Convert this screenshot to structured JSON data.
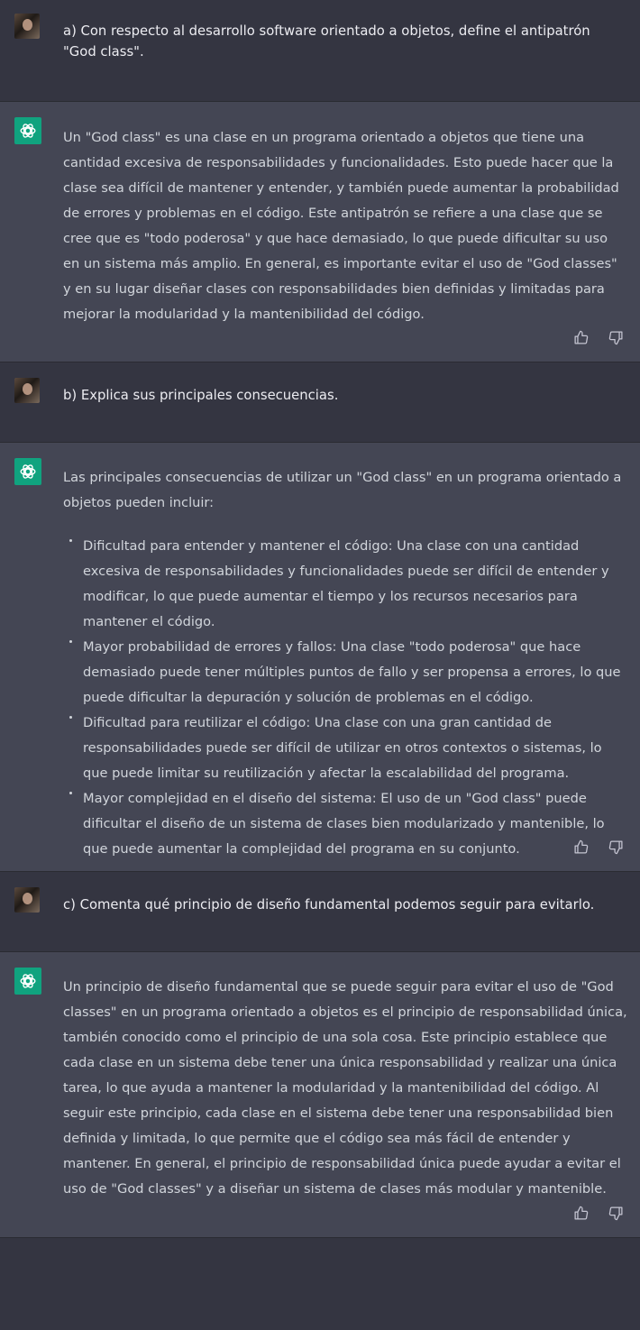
{
  "theme": {
    "user_bg": "#343541",
    "assistant_bg": "#444654",
    "accent": "#10a37f"
  },
  "messages": [
    {
      "role": "user",
      "text": "a) Con respecto al desarrollo software orientado a objetos, define el antipatrón \"God class\"."
    },
    {
      "role": "assistant",
      "text": "Un \"God class\" es una clase en un programa orientado a objetos que tiene una cantidad excesiva de responsabilidades y funcionalidades. Esto puede hacer que la clase sea difícil de mantener y entender, y también puede aumentar la probabilidad de errores y problemas en el código. Este antipatrón se refiere a una clase que se cree que es \"todo poderosa\" y que hace demasiado, lo que puede dificultar su uso en un sistema más amplio. En general, es importante evitar el uso de \"God classes\" y en su lugar diseñar clases con responsabilidades bien definidas y limitadas para mejorar la modularidad y la mantenibilidad del código."
    },
    {
      "role": "user",
      "text": "b) Explica sus principales consecuencias."
    },
    {
      "role": "assistant",
      "intro": "Las principales consecuencias de utilizar un \"God class\" en un programa orientado a objetos pueden incluir:",
      "bullets": [
        "Dificultad para entender y mantener el código: Una clase con una cantidad excesiva de responsabilidades y funcionalidades puede ser difícil de entender y modificar, lo que puede aumentar el tiempo y los recursos necesarios para mantener el código.",
        "Mayor probabilidad de errores y fallos: Una clase \"todo poderosa\" que hace demasiado puede tener múltiples puntos de fallo y ser propensa a errores, lo que puede dificultar la depuración y solución de problemas en el código.",
        "Dificultad para reutilizar el código: Una clase con una gran cantidad de responsabilidades puede ser difícil de utilizar en otros contextos o sistemas, lo que puede limitar su reutilización y afectar la escalabilidad del programa.",
        "Mayor complejidad en el diseño del sistema: El uso de un \"God class\" puede dificultar el diseño de un sistema de clases bien modularizado y mantenible, lo que puede aumentar la complejidad del programa en su conjunto."
      ]
    },
    {
      "role": "user",
      "text": "c) Comenta qué principio de diseño fundamental podemos seguir para evitarlo."
    },
    {
      "role": "assistant",
      "text": "Un principio de diseño fundamental que se puede seguir para evitar el uso de \"God classes\" en un programa orientado a objetos es el principio de responsabilidad única, también conocido como el principio de una sola cosa. Este principio establece que cada clase en un sistema debe tener una única responsabilidad y realizar una única tarea, lo que ayuda a mantener la modularidad y la mantenibilidad del código. Al seguir este principio, cada clase en el sistema debe tener una responsabilidad bien definida y limitada, lo que permite que el código sea más fácil de entender y mantener. En general, el principio de responsabilidad única puede ayudar a evitar el uso de \"God classes\" y a diseñar un sistema de clases más modular y mantenible."
    }
  ]
}
